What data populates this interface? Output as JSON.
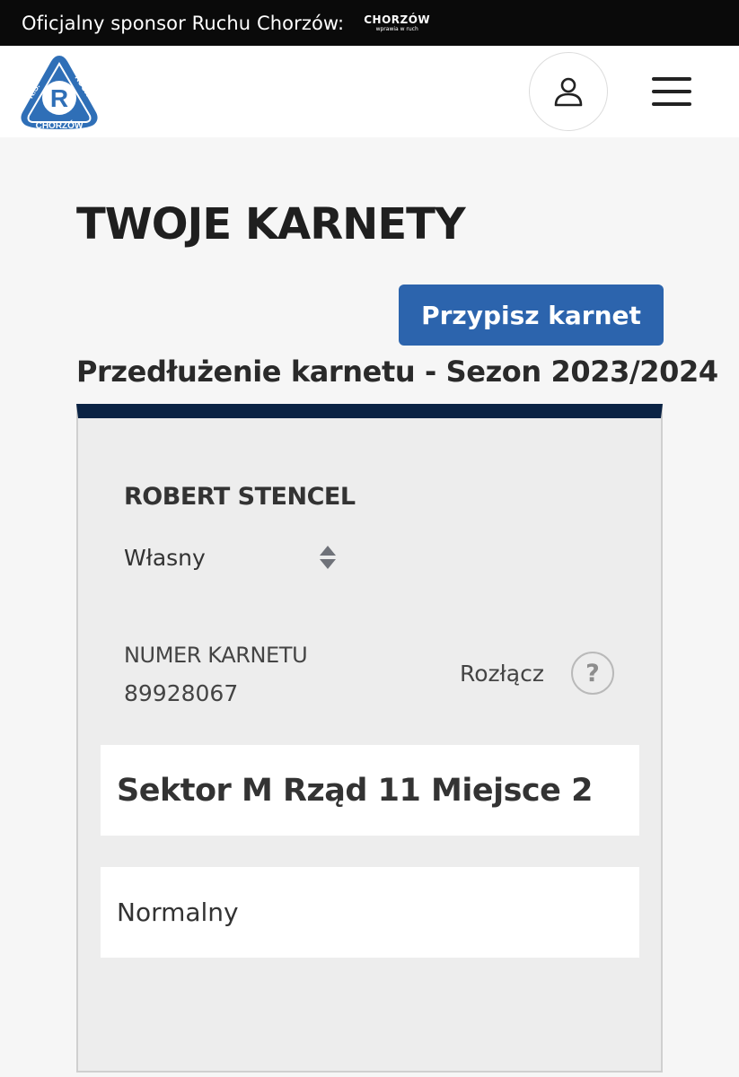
{
  "sponsor_bar": {
    "text": "Oficjalny sponsor Ruchu Chorzów:",
    "logo_main": "CHORZÓW",
    "logo_sub": "wprawia w ruch"
  },
  "header": {
    "club_logo": {
      "top_text": "K.S.",
      "side_text": "RUCH",
      "bottom_text": "CHORZÓW",
      "letter": "R",
      "colors": {
        "blue": "#2f6fb7",
        "white": "#ffffff"
      }
    },
    "user_icon": "user-icon",
    "menu_icon": "hamburger-menu-icon"
  },
  "page": {
    "title": "TWOJE KARNETY",
    "assign_button_label": "Przypisz karnet",
    "section_heading": "Przedłużenie karnetu - Sezon 2023/2024"
  },
  "card": {
    "holder_name": "ROBERT STENCEL",
    "owner_select_value": "Własny",
    "number_label": "NUMER KARNETU",
    "number_value": "89928067",
    "disconnect_label": "Rozłącz",
    "help_symbol": "?",
    "seat": "Sektor M Rząd 11 Miejsce 2",
    "ticket_type": "Normalny"
  },
  "colors": {
    "accent_button": "#2c64ad",
    "card_top_border": "#0b2344",
    "sponsor_bar": "#0a0a0a"
  }
}
